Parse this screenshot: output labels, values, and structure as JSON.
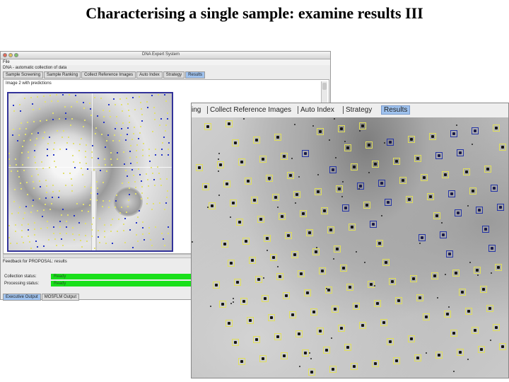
{
  "slide": {
    "title": "Characterising a single sample: examine results III"
  },
  "window": {
    "title": "DNA Expert System",
    "menu": "File",
    "crumb": "DNA - automatic collection of data",
    "tabs": [
      "Sample Screening",
      "Sample Ranking",
      "Collect Reference Images",
      "Auto Index",
      "Strategy",
      "Results"
    ],
    "active_tab": "Results",
    "image_label": "Image 2 with predictions",
    "feedback_label": "Feedback for PROPOSAL: results",
    "collection_label": "Collection status:",
    "collection_value": "Ready",
    "processing_label": "Processing status:",
    "processing_value": "Ready",
    "bottom_tabs": [
      "Executive Output",
      "MOSFLM Output"
    ],
    "status_color": "#19e01a",
    "accent_tab_color": "#9fc2ee"
  },
  "zoom": {
    "tabs": [
      "ing",
      "Collect Reference Images",
      "Auto Index",
      "Strategy",
      "Results"
    ],
    "active_tab": "Results",
    "prediction_colors": {
      "predicted": "#e1e05a",
      "overlap": "#2535a8"
    }
  }
}
